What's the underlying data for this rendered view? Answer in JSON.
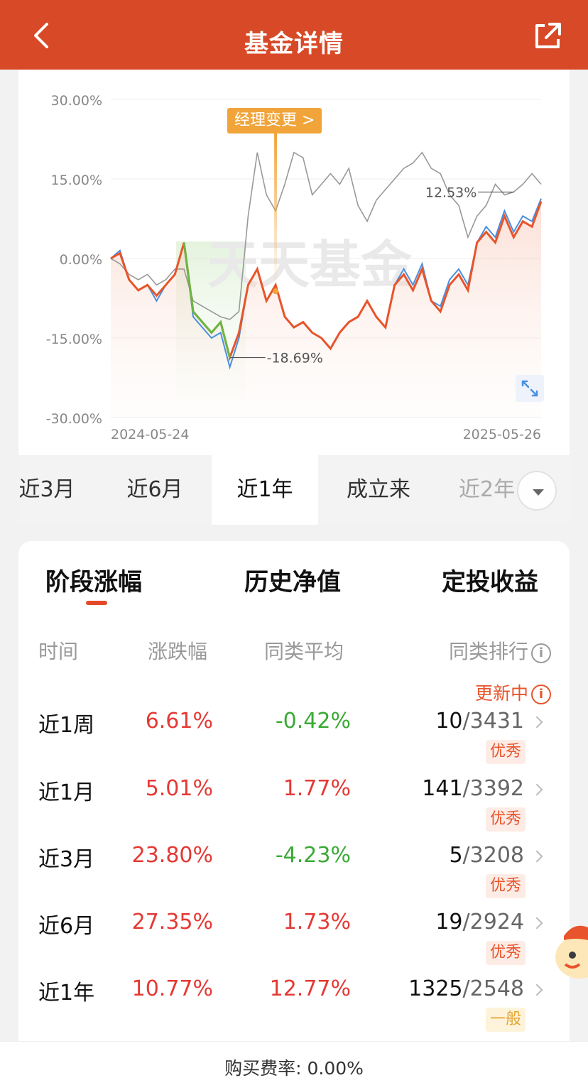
{
  "header": {
    "title": "基金详情",
    "back_icon": "back-arrow-icon",
    "share_icon": "share-icon"
  },
  "chart": {
    "watermark": "天天基金",
    "manager_change_label": "经理变更 >",
    "max_label": "12.53%",
    "min_label": "-18.69%",
    "start_date": "2024-05-24",
    "end_date": "2025-05-26",
    "y_ticks": [
      "30.00%",
      "15.00%",
      "0.00%",
      "-15.00%",
      "-30.00%"
    ],
    "colors": {
      "fund": "#e8542b",
      "benchmark": "#4a8fe0",
      "index": "#999999",
      "marker": "#f0a43a",
      "highlight": "#6ab743"
    }
  },
  "chart_data": {
    "type": "line",
    "x_range": [
      "2024-05-24",
      "2025-05-26"
    ],
    "ylim": [
      -30,
      30
    ],
    "y_unit": "%",
    "series": [
      {
        "values": [
          0,
          1,
          -4,
          -6,
          -5,
          -7,
          -5,
          -3,
          3,
          -10,
          -12,
          -14,
          -12,
          -18.69,
          -14,
          -5,
          -2,
          -8,
          -5,
          -11,
          -13,
          -12,
          -14,
          -15,
          -17,
          -14,
          -12,
          -11,
          -8,
          -11,
          -13,
          -5,
          -3,
          -6,
          -2,
          -8,
          -10,
          -5,
          -3,
          -6,
          3,
          5,
          3,
          8,
          4,
          7,
          6,
          10.77
        ]
      },
      {
        "values": [
          0,
          1.5,
          -4,
          -6,
          -5,
          -8,
          -5,
          -3,
          3,
          -11,
          -13,
          -15,
          -14,
          -20.5,
          -15,
          -5,
          -2,
          -8,
          -5,
          -11,
          -13,
          -12,
          -14,
          -15,
          -17,
          -14,
          -12,
          -11,
          -8,
          -11,
          -13,
          -5,
          -2,
          -5,
          -1,
          -8,
          -9,
          -4,
          -2,
          -5,
          3,
          6,
          4,
          9,
          5,
          8,
          7,
          11.3
        ]
      },
      {
        "values": [
          0,
          -1,
          -3,
          -4,
          -3,
          -5,
          -4,
          -2,
          -2,
          -8,
          -9,
          -10,
          -11,
          -11.5,
          -10,
          8,
          20,
          12,
          9,
          14,
          20,
          19,
          12,
          14,
          16,
          14,
          17,
          10,
          7,
          11,
          13,
          15,
          17,
          18,
          20,
          17,
          16,
          12,
          10,
          4,
          8,
          10,
          14,
          12,
          12.53,
          14,
          16,
          14
        ]
      }
    ]
  },
  "period_tabs": [
    "近3月",
    "近6月",
    "近1年",
    "成立来",
    "近2年"
  ],
  "active_period": "近1年",
  "stat_tabs": [
    "阶段涨幅",
    "历史净值",
    "定投收益"
  ],
  "columns": {
    "time": "时间",
    "change": "涨跌幅",
    "avg": "同类平均",
    "rank": "同类排行"
  },
  "updating_label": "更新中",
  "rows": [
    {
      "period": "近1周",
      "change": "6.61%",
      "avg": "-0.42%",
      "rank": "10",
      "total": "/3431",
      "badge": "优秀"
    },
    {
      "period": "近1月",
      "change": "5.01%",
      "avg": "1.77%",
      "rank": "141",
      "total": "/3392",
      "badge": "优秀"
    },
    {
      "period": "近3月",
      "change": "23.80%",
      "avg": "-4.23%",
      "rank": "5",
      "total": "/3208",
      "badge": "优秀"
    },
    {
      "period": "近6月",
      "change": "27.35%",
      "avg": "1.73%",
      "rank": "19",
      "total": "/2924",
      "badge": "优秀"
    },
    {
      "period": "近1年",
      "change": "10.77%",
      "avg": "12.77%",
      "rank": "1325",
      "total": "/2548",
      "badge": "一般"
    }
  ],
  "footer": {
    "fee_label": "购买费率:",
    "fee_value": "0.00%"
  }
}
